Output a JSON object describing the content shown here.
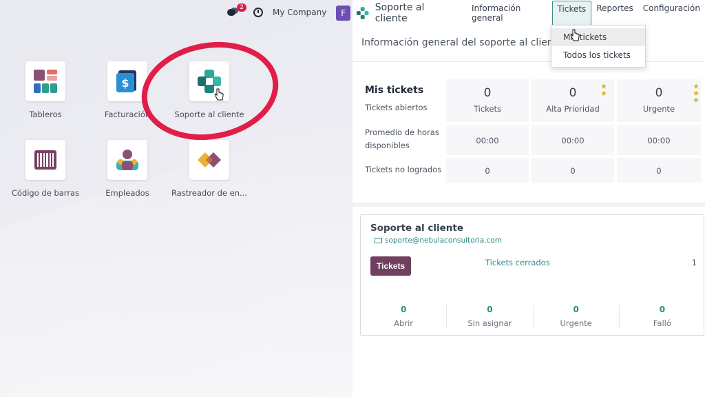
{
  "launcher": {
    "apps": [
      {
        "label": "Tableros",
        "icon": "dashboard-icon"
      },
      {
        "label": "Facturación",
        "icon": "invoicing-icon"
      },
      {
        "label": "Soporte al cliente",
        "icon": "helpdesk-icon"
      },
      {
        "label": "Código de barras",
        "icon": "barcode-icon"
      },
      {
        "label": "Empleados",
        "icon": "employees-icon"
      },
      {
        "label": "Rastreador de en...",
        "icon": "timesheet-icon"
      }
    ]
  },
  "systray": {
    "messages_badge": "2",
    "company": "My Company"
  },
  "topbar": {
    "avatar_initial": "F",
    "app_name": "Soporte al cliente",
    "menu": [
      "Información general",
      "Tickets",
      "Reportes",
      "Configuración"
    ]
  },
  "dropdown": {
    "items": [
      "Mis tickets",
      "Todos los tickets"
    ]
  },
  "control_panel": {
    "title": "Información general del soporte al cliente"
  },
  "my_tickets": {
    "title": "Mis tickets",
    "row_labels": [
      "Tickets abiertos",
      "Promedio de horas disponibles",
      "Tickets no logrados"
    ],
    "columns": [
      {
        "count": "0",
        "label": "Tickets",
        "hours": "00:00",
        "failed": "0"
      },
      {
        "count": "0",
        "label": "Alta Prioridad",
        "hours": "00:00",
        "failed": "0"
      },
      {
        "count": "0",
        "label": "Urgente",
        "hours": "00:00",
        "failed": "0"
      }
    ]
  },
  "team": {
    "name": "Soporte al cliente",
    "email": "soporte@nebulaconsultoria.com",
    "button": "Tickets",
    "closed_label": "Tickets cerrados",
    "closed_count": "1",
    "footer": [
      {
        "count": "0",
        "label": "Abrir"
      },
      {
        "count": "0",
        "label": "Sin asignar"
      },
      {
        "count": "0",
        "label": "Urgente"
      },
      {
        "count": "0",
        "label": "Falló"
      }
    ]
  },
  "colors": {
    "accent_teal": "#2d8a85",
    "button_plum": "#71405f",
    "annotation_red": "#e11d48",
    "star_gold": "#d4b62a"
  }
}
